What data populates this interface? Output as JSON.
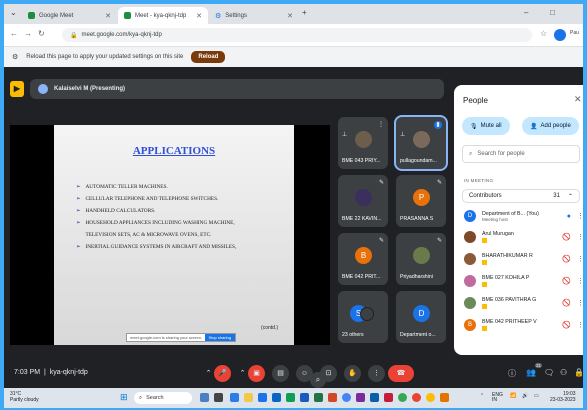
{
  "browser": {
    "tabs": [
      {
        "label": "Google Meet",
        "color": "#1e8e3e"
      },
      {
        "label": "Meet - kya-qknj-tdp",
        "color": "#1e8e3e"
      },
      {
        "label": "Settings",
        "color": "#5f6368"
      }
    ],
    "url": "meet.google.com/kya-qknj-tdp",
    "window_controls": {
      "minimize": "–",
      "restore": "□"
    },
    "profile_label": "Pau"
  },
  "infobar": {
    "message": "Reload this page to apply your updated settings on this site",
    "reload_label": "Reload"
  },
  "meet": {
    "presenting_label": "Kalaiselvi M (Presenting)",
    "slide": {
      "title": "APPLICATIONS",
      "bullets": [
        "AUTOMATIC TELLER MACHINES.",
        "CELLULAR TELEPHONE AND TELEPHONE SWITCHES.",
        "HANDHELD CALCULATORS.",
        "HOUSEHOLD APPLIANCES INCLUDING WASHING MACHINE,",
        "TELEVISION SETS, AC & MICROWAVE OVENS, ETC.",
        "INERTIAL GUIDANCE SYSTEMS IN AIRCRAFT AND MISSILES,"
      ],
      "contd": "(contd.)",
      "share_banner": "meet.google.com is sharing your screen.",
      "stop_label": "Stop sharing"
    },
    "tiles": [
      {
        "name": "BME 043 PRIY...",
        "initial": "",
        "color": "#6d5d4b"
      },
      {
        "name": "pullagoundam...",
        "initial": "",
        "color": "#7b6a5a"
      },
      {
        "name": "BME 22 KAVIN...",
        "initial": "",
        "color": "#3b2f5e"
      },
      {
        "name": "PRASANNA S",
        "initial": "P",
        "color": "#e8710a"
      },
      {
        "name": "BME 042 PRIT...",
        "initial": "B",
        "color": "#e8710a"
      },
      {
        "name": "Priyadharshini",
        "initial": "",
        "color": "#6b7a4a"
      },
      {
        "name": "23 others",
        "initial": "S",
        "color": "#1a73e8"
      },
      {
        "name": "Department o...",
        "initial": "D",
        "color": "#1a73e8"
      }
    ]
  },
  "people_panel": {
    "title": "People",
    "mute_all": "Mute all",
    "add_people": "Add people",
    "search_placeholder": "Search for people",
    "in_meeting_label": "IN MEETING",
    "contributors_label": "Contributors",
    "contributors_count": "31",
    "people": [
      {
        "name": "Department of B...",
        "tag": "(You)",
        "sub": "Meeting host",
        "initial": "D",
        "color": "#1a73e8"
      },
      {
        "name": "Arul Murugan",
        "tag": "",
        "sub": "",
        "initial": "",
        "color": "#7b4a2a"
      },
      {
        "name": "BHARATHIKUMAR R",
        "tag": "",
        "sub": "",
        "initial": "",
        "color": "#8a5a3a"
      },
      {
        "name": "BME 027 KOHILA P",
        "tag": "",
        "sub": "",
        "initial": "",
        "color": "#c06aa0"
      },
      {
        "name": "BME 036 PAVITHRA G",
        "tag": "",
        "sub": "",
        "initial": "",
        "color": "#6a8a5a"
      },
      {
        "name": "BME 042 PRITHEEP V",
        "tag": "",
        "sub": "",
        "initial": "B",
        "color": "#e8710a"
      }
    ]
  },
  "bottom_bar": {
    "time": "7:03 PM",
    "meeting_code": "kya-qknj-tdp",
    "participants_count": "31"
  },
  "taskbar": {
    "temperature": "31°C",
    "weather": "Partly cloudy",
    "search_label": "Search",
    "language": "ENG",
    "region": "IN",
    "time": "19:03",
    "date": "23-03-2023"
  }
}
